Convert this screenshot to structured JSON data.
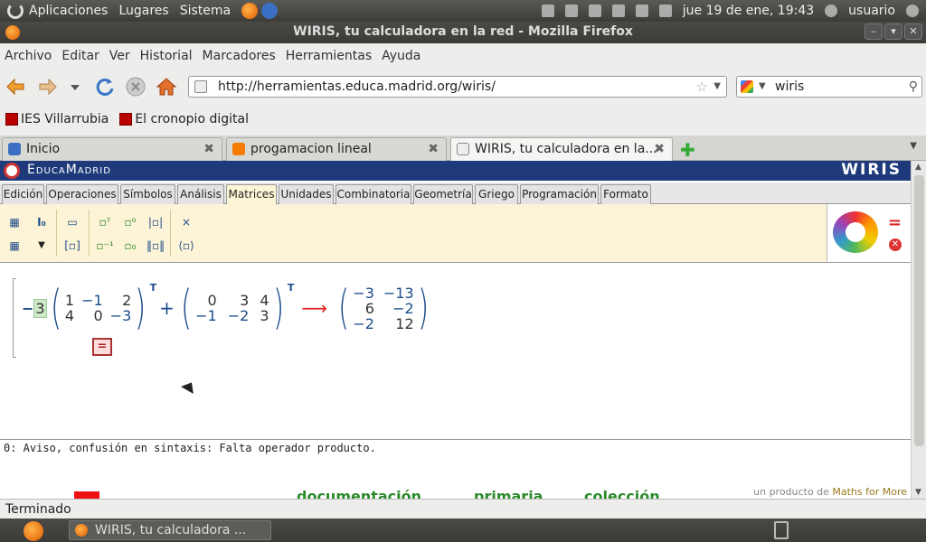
{
  "panel": {
    "menus": [
      "Aplicaciones",
      "Lugares",
      "Sistema"
    ],
    "datetime": "jue 19 de ene, 19:43",
    "user": "usuario"
  },
  "window": {
    "title": "WIRIS, tu calculadora en la red - Mozilla Firefox"
  },
  "menubar": {
    "items": [
      "Archivo",
      "Editar",
      "Ver",
      "Historial",
      "Marcadores",
      "Herramientas",
      "Ayuda"
    ]
  },
  "navigation": {
    "url": "http://herramientas.educa.madrid.org/wiris/",
    "search_value": "wiris"
  },
  "bookmarks": {
    "items": [
      "IES Villarrubia",
      "El cronopio digital"
    ]
  },
  "tabs": {
    "items": [
      {
        "label": "Inicio"
      },
      {
        "label": "progamacion lineal"
      },
      {
        "label": "WIRIS, tu calculadora en la..."
      }
    ],
    "active_index": 2
  },
  "wiris": {
    "site_name": "EducaMadrid",
    "brand": "WIRIS",
    "tabs": [
      "Edición",
      "Operaciones",
      "Símbolos",
      "Análisis",
      "Matrices",
      "Unidades",
      "Combinatoria",
      "Geometría",
      "Griego",
      "Programación",
      "Formato"
    ],
    "active_tab": "Matrices",
    "toolbar_icons": [
      "matrix-grid-icon",
      "identity-matrix-icon",
      "row-vector-icon",
      "transpose-icon",
      "power-zero-icon",
      "determinant-icon",
      "matrix-grid-dropdown-icon",
      "dropdown-arrow-icon",
      "column-vector-icon",
      "inverse-icon",
      "subscript-zero-icon",
      "norm-icon",
      "cross-product-icon",
      "dot-product-icon"
    ],
    "toolbar_labels": {
      "identity": "I₀",
      "cross": "×"
    },
    "expression": {
      "scalar": "3",
      "matrix_a": [
        [
          "1",
          "−1",
          "2"
        ],
        [
          "4",
          "0",
          "−3"
        ]
      ],
      "matrix_b": [
        [
          "0",
          "3",
          "4"
        ],
        [
          "−1",
          "−2",
          "3"
        ]
      ],
      "result": [
        [
          "−3",
          "−13"
        ],
        [
          "6",
          "−2"
        ],
        [
          "−2",
          "12"
        ]
      ],
      "transpose_mark": "T",
      "operator_plus": "+",
      "equals_label": "="
    },
    "message": "0: Aviso, confusión en sintaxis: Falta operador producto.",
    "footer_links": [
      "documentación",
      "primaria",
      "colección"
    ],
    "credit_prefix": "un producto de",
    "credit_brand": "Maths for More"
  },
  "status": {
    "text": "Terminado"
  },
  "taskbar": {
    "task_label": "WIRIS, tu calculadora ..."
  }
}
